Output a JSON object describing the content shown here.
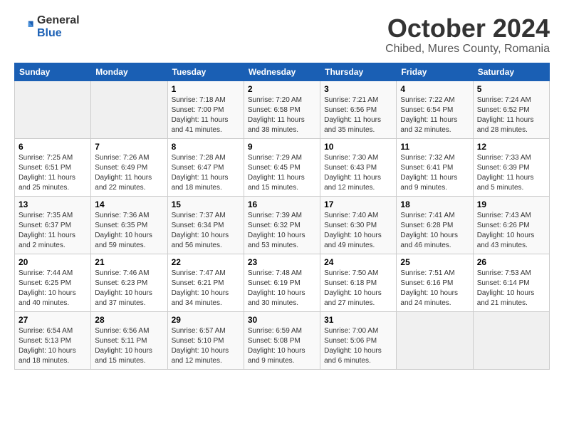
{
  "logo": {
    "general": "General",
    "blue": "Blue"
  },
  "title": "October 2024",
  "location": "Chibed, Mures County, Romania",
  "days_header": [
    "Sunday",
    "Monday",
    "Tuesday",
    "Wednesday",
    "Thursday",
    "Friday",
    "Saturday"
  ],
  "weeks": [
    [
      {
        "day": "",
        "info": ""
      },
      {
        "day": "",
        "info": ""
      },
      {
        "day": "1",
        "info": "Sunrise: 7:18 AM\nSunset: 7:00 PM\nDaylight: 11 hours and 41 minutes."
      },
      {
        "day": "2",
        "info": "Sunrise: 7:20 AM\nSunset: 6:58 PM\nDaylight: 11 hours and 38 minutes."
      },
      {
        "day": "3",
        "info": "Sunrise: 7:21 AM\nSunset: 6:56 PM\nDaylight: 11 hours and 35 minutes."
      },
      {
        "day": "4",
        "info": "Sunrise: 7:22 AM\nSunset: 6:54 PM\nDaylight: 11 hours and 32 minutes."
      },
      {
        "day": "5",
        "info": "Sunrise: 7:24 AM\nSunset: 6:52 PM\nDaylight: 11 hours and 28 minutes."
      }
    ],
    [
      {
        "day": "6",
        "info": "Sunrise: 7:25 AM\nSunset: 6:51 PM\nDaylight: 11 hours and 25 minutes."
      },
      {
        "day": "7",
        "info": "Sunrise: 7:26 AM\nSunset: 6:49 PM\nDaylight: 11 hours and 22 minutes."
      },
      {
        "day": "8",
        "info": "Sunrise: 7:28 AM\nSunset: 6:47 PM\nDaylight: 11 hours and 18 minutes."
      },
      {
        "day": "9",
        "info": "Sunrise: 7:29 AM\nSunset: 6:45 PM\nDaylight: 11 hours and 15 minutes."
      },
      {
        "day": "10",
        "info": "Sunrise: 7:30 AM\nSunset: 6:43 PM\nDaylight: 11 hours and 12 minutes."
      },
      {
        "day": "11",
        "info": "Sunrise: 7:32 AM\nSunset: 6:41 PM\nDaylight: 11 hours and 9 minutes."
      },
      {
        "day": "12",
        "info": "Sunrise: 7:33 AM\nSunset: 6:39 PM\nDaylight: 11 hours and 5 minutes."
      }
    ],
    [
      {
        "day": "13",
        "info": "Sunrise: 7:35 AM\nSunset: 6:37 PM\nDaylight: 11 hours and 2 minutes."
      },
      {
        "day": "14",
        "info": "Sunrise: 7:36 AM\nSunset: 6:35 PM\nDaylight: 10 hours and 59 minutes."
      },
      {
        "day": "15",
        "info": "Sunrise: 7:37 AM\nSunset: 6:34 PM\nDaylight: 10 hours and 56 minutes."
      },
      {
        "day": "16",
        "info": "Sunrise: 7:39 AM\nSunset: 6:32 PM\nDaylight: 10 hours and 53 minutes."
      },
      {
        "day": "17",
        "info": "Sunrise: 7:40 AM\nSunset: 6:30 PM\nDaylight: 10 hours and 49 minutes."
      },
      {
        "day": "18",
        "info": "Sunrise: 7:41 AM\nSunset: 6:28 PM\nDaylight: 10 hours and 46 minutes."
      },
      {
        "day": "19",
        "info": "Sunrise: 7:43 AM\nSunset: 6:26 PM\nDaylight: 10 hours and 43 minutes."
      }
    ],
    [
      {
        "day": "20",
        "info": "Sunrise: 7:44 AM\nSunset: 6:25 PM\nDaylight: 10 hours and 40 minutes."
      },
      {
        "day": "21",
        "info": "Sunrise: 7:46 AM\nSunset: 6:23 PM\nDaylight: 10 hours and 37 minutes."
      },
      {
        "day": "22",
        "info": "Sunrise: 7:47 AM\nSunset: 6:21 PM\nDaylight: 10 hours and 34 minutes."
      },
      {
        "day": "23",
        "info": "Sunrise: 7:48 AM\nSunset: 6:19 PM\nDaylight: 10 hours and 30 minutes."
      },
      {
        "day": "24",
        "info": "Sunrise: 7:50 AM\nSunset: 6:18 PM\nDaylight: 10 hours and 27 minutes."
      },
      {
        "day": "25",
        "info": "Sunrise: 7:51 AM\nSunset: 6:16 PM\nDaylight: 10 hours and 24 minutes."
      },
      {
        "day": "26",
        "info": "Sunrise: 7:53 AM\nSunset: 6:14 PM\nDaylight: 10 hours and 21 minutes."
      }
    ],
    [
      {
        "day": "27",
        "info": "Sunrise: 6:54 AM\nSunset: 5:13 PM\nDaylight: 10 hours and 18 minutes."
      },
      {
        "day": "28",
        "info": "Sunrise: 6:56 AM\nSunset: 5:11 PM\nDaylight: 10 hours and 15 minutes."
      },
      {
        "day": "29",
        "info": "Sunrise: 6:57 AM\nSunset: 5:10 PM\nDaylight: 10 hours and 12 minutes."
      },
      {
        "day": "30",
        "info": "Sunrise: 6:59 AM\nSunset: 5:08 PM\nDaylight: 10 hours and 9 minutes."
      },
      {
        "day": "31",
        "info": "Sunrise: 7:00 AM\nSunset: 5:06 PM\nDaylight: 10 hours and 6 minutes."
      },
      {
        "day": "",
        "info": ""
      },
      {
        "day": "",
        "info": ""
      }
    ]
  ]
}
